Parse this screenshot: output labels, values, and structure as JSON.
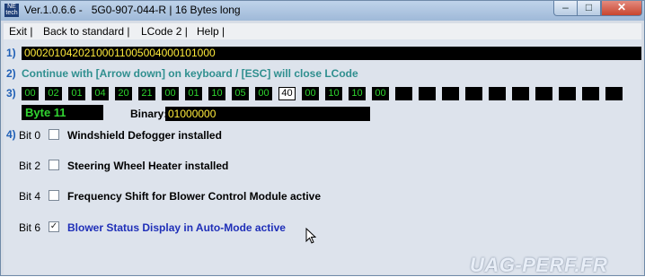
{
  "window": {
    "title": "Ver.1.0.6.6 -   5G0-907-044-R | 16 Bytes long",
    "logo_text": "NE tech",
    "controls": {
      "minimize": "–",
      "maximize": "□",
      "close": "✕"
    }
  },
  "menu": [
    {
      "label": "Exit |"
    },
    {
      "label": "Back to standard |"
    },
    {
      "label": "LCode 2 |"
    },
    {
      "label": "Help |"
    }
  ],
  "rows": {
    "row1": "1)",
    "row2": "2)",
    "row3": "3)",
    "row4": "4)"
  },
  "code_string": "00020104202100011005004000101000",
  "instruction": "Continue with [Arrow down] on keyboard / [ESC] will close LCode",
  "bytes": [
    "00",
    "02",
    "01",
    "04",
    "20",
    "21",
    "00",
    "01",
    "10",
    "05",
    "00",
    "40",
    "00",
    "10",
    "10",
    "00"
  ],
  "selected_byte_index": 11,
  "byte_label": "Byte 11",
  "binary": {
    "label": "Binary:",
    "value": "01000000"
  },
  "bits": [
    {
      "label": "Bit 0",
      "text": "Windshield Defogger installed",
      "checked": false
    },
    {
      "label": "Bit 2",
      "text": "Steering Wheel Heater installed",
      "checked": false
    },
    {
      "label": "Bit 4",
      "text": "Frequency Shift for Blower Control Module active",
      "checked": false
    },
    {
      "label": "Bit 6",
      "text": "Blower Status Display in Auto-Mode active",
      "checked": true
    }
  ],
  "watermark": "UAG-PERF.FR",
  "colors": {
    "code_text": "#ffeb3b",
    "byte_text": "#2ed42e",
    "instruction": "#2f8f8f",
    "active_bit": "#1f2fb8"
  }
}
